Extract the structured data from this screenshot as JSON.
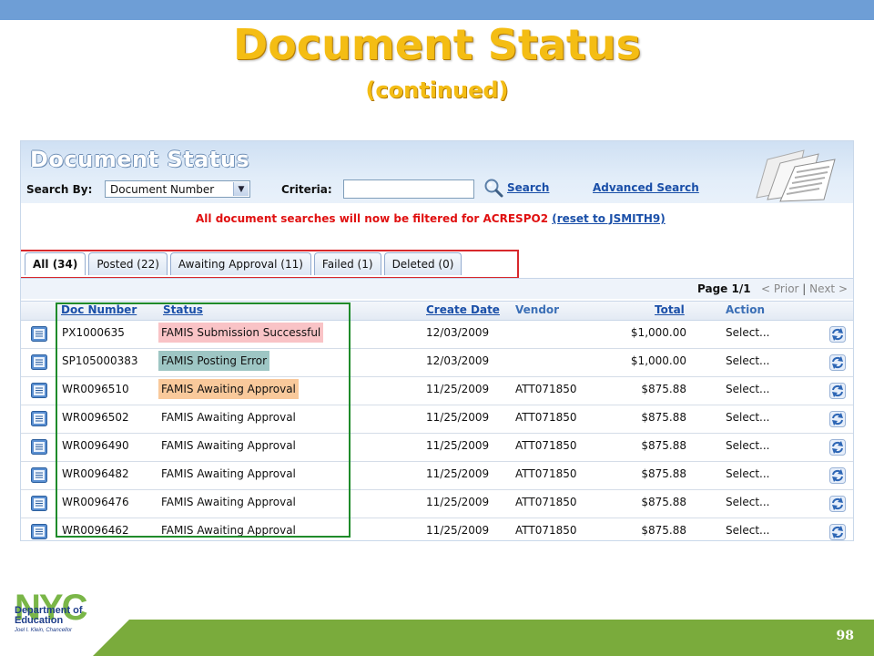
{
  "slide": {
    "title": "Document Status",
    "subtitle": "(continued)",
    "page_number": "98"
  },
  "app": {
    "title": "Document Status",
    "search_by_label": "Search By:",
    "search_by_value": "Document Number",
    "criteria_label": "Criteria:",
    "criteria_value": "",
    "search_link": "Search",
    "advanced_search_link": "Advanced Search",
    "notice_text": "All document searches will now be filtered for ACRESPO2",
    "notice_link": "(reset to JSMITH9)"
  },
  "tabs": [
    {
      "label": "All (34)",
      "active": true
    },
    {
      "label": "Posted (22)",
      "active": false
    },
    {
      "label": "Awaiting Approval (11)",
      "active": false
    },
    {
      "label": "Failed (1)",
      "active": false
    },
    {
      "label": "Deleted (0)",
      "active": false
    }
  ],
  "pager": {
    "page": "Page 1/1",
    "prior": "< Prior",
    "separator": "|",
    "next": "Next >"
  },
  "table": {
    "headers": {
      "doc_number": "Doc Number",
      "status": "Status",
      "create_date": "Create Date",
      "vendor": "Vendor",
      "total": "Total",
      "action": "Action"
    },
    "rows": [
      {
        "doc_number": "PX1000635",
        "status": "FAMIS Submission Successful",
        "status_color": "#f9c3c6",
        "create_date": "12/03/2009",
        "vendor": "",
        "total": "$1,000.00",
        "action": "Select..."
      },
      {
        "doc_number": "SP105000383",
        "status": "FAMIS Posting Error",
        "status_color": "#9ec6c4",
        "create_date": "12/03/2009",
        "vendor": "",
        "total": "$1,000.00",
        "action": "Select..."
      },
      {
        "doc_number": "WR0096510",
        "status": "FAMIS Awaiting Approval",
        "status_color": "#f9c99b",
        "create_date": "11/25/2009",
        "vendor": "ATT071850",
        "total": "$875.88",
        "action": "Select..."
      },
      {
        "doc_number": "WR0096502",
        "status": "FAMIS Awaiting Approval",
        "status_color": "",
        "create_date": "11/25/2009",
        "vendor": "ATT071850",
        "total": "$875.88",
        "action": "Select..."
      },
      {
        "doc_number": "WR0096490",
        "status": "FAMIS Awaiting Approval",
        "status_color": "",
        "create_date": "11/25/2009",
        "vendor": "ATT071850",
        "total": "$875.88",
        "action": "Select..."
      },
      {
        "doc_number": "WR0096482",
        "status": "FAMIS Awaiting Approval",
        "status_color": "",
        "create_date": "11/25/2009",
        "vendor": "ATT071850",
        "total": "$875.88",
        "action": "Select..."
      },
      {
        "doc_number": "WR0096476",
        "status": "FAMIS Awaiting Approval",
        "status_color": "",
        "create_date": "11/25/2009",
        "vendor": "ATT071850",
        "total": "$875.88",
        "action": "Select..."
      },
      {
        "doc_number": "WR0096462",
        "status": "FAMIS Awaiting Approval",
        "status_color": "",
        "create_date": "11/25/2009",
        "vendor": "ATT071850",
        "total": "$875.88",
        "action": "Select..."
      }
    ]
  },
  "footer": {
    "logo_text": "NYC",
    "dept_line1": "Department of",
    "dept_line2": "Education",
    "chancellor": "Joel I. Klein, Chancellor"
  },
  "icons": {
    "doc": "document-icon",
    "refresh": "refresh-icon",
    "search": "magnifier-icon",
    "newspaper": "newspaper-icon"
  },
  "colors": {
    "title": "#f4bd14",
    "top_bar": "#6e9ed6",
    "footer_bar": "#7aab3c",
    "tab_outline": "#d8282c",
    "row_outline": "#1f8b2a",
    "link": "#1a4fa8",
    "notice": "#e01010"
  }
}
